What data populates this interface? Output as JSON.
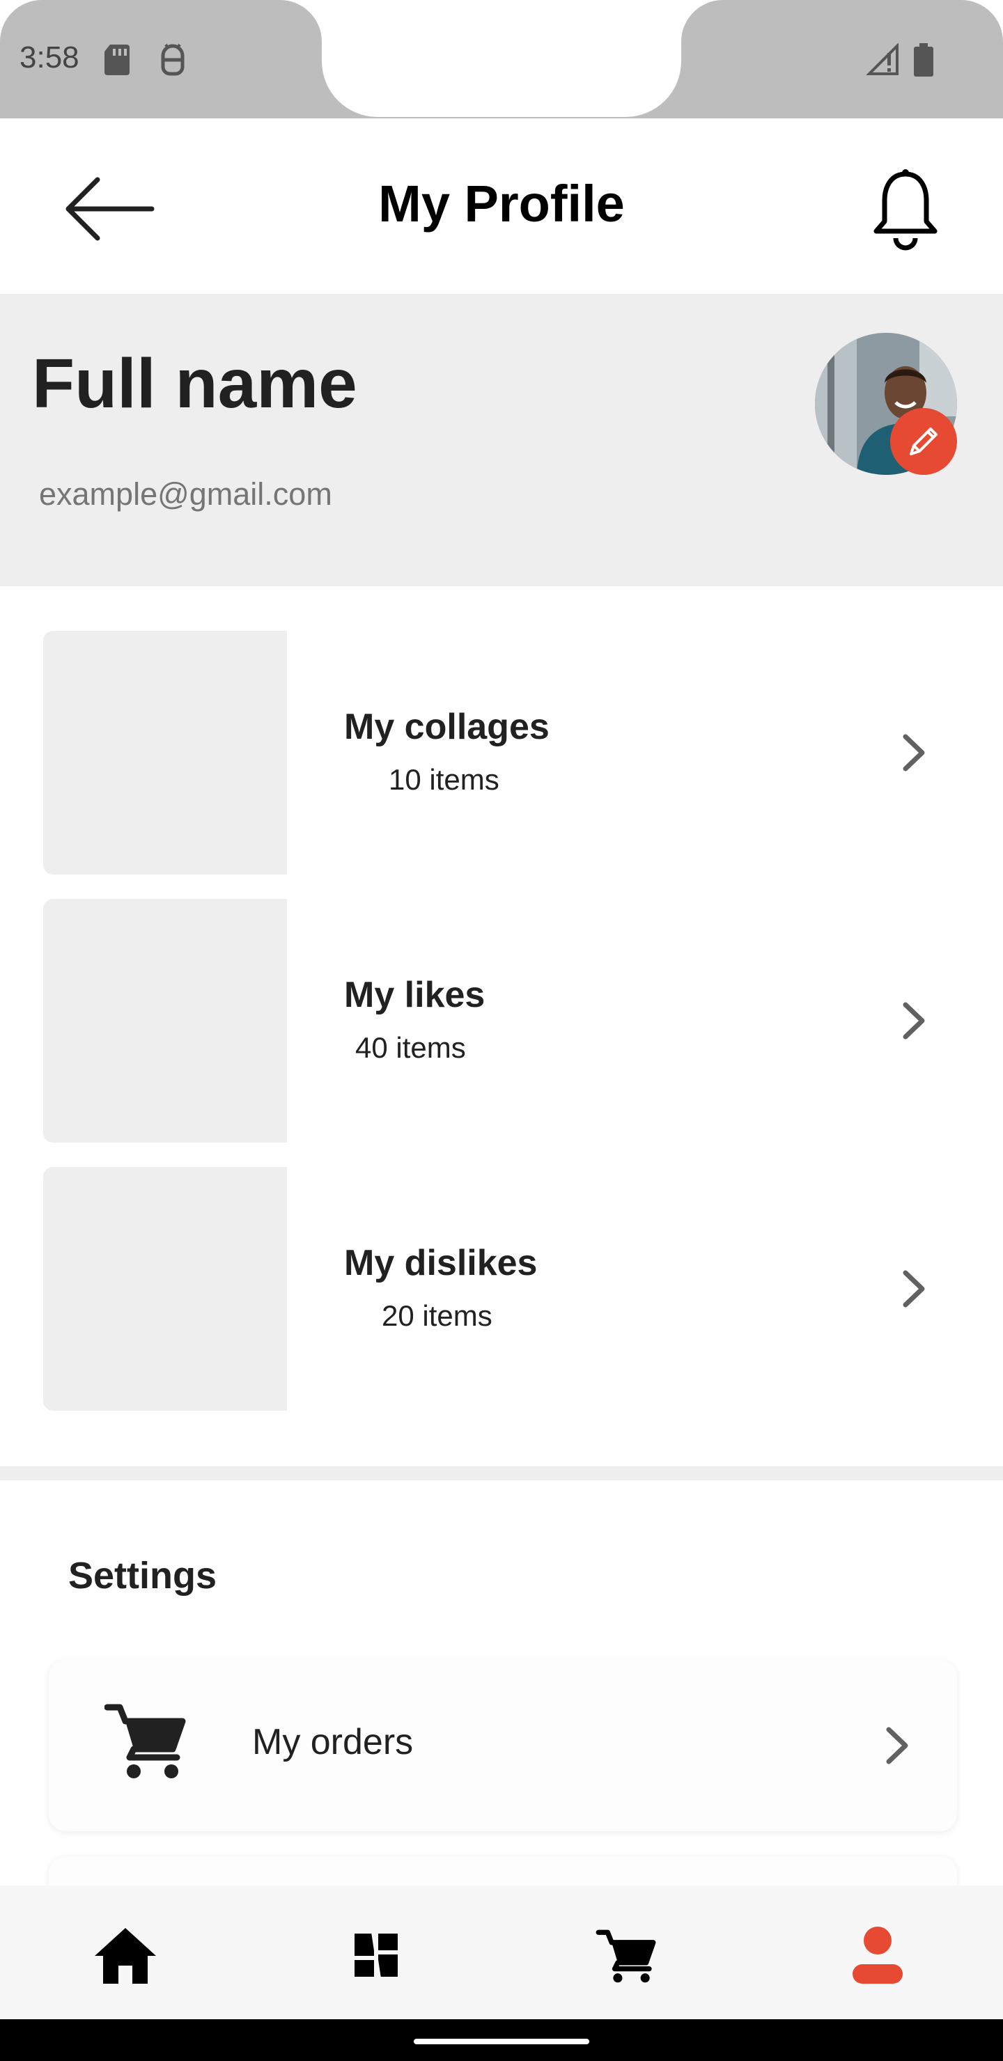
{
  "status_bar": {
    "time": "3:58",
    "icons": [
      "sd-card-icon",
      "android-debug-icon",
      "signal-icon",
      "battery-icon"
    ]
  },
  "header": {
    "title": "My Profile",
    "back_icon": "arrow-left-icon",
    "bell_icon": "bell-icon"
  },
  "profile": {
    "name": "Full name",
    "email": "example@gmail.com",
    "edit_icon": "pencil-icon"
  },
  "collections": [
    {
      "title": "My collages",
      "count": "10 items"
    },
    {
      "title": "My likes",
      "count": "40 items"
    },
    {
      "title": "My dislikes",
      "count": "20 items"
    }
  ],
  "settings": {
    "title": "Settings",
    "items": [
      {
        "label": "My orders",
        "icon": "cart-icon"
      }
    ]
  },
  "bottom_nav": {
    "items": [
      "home-icon",
      "collage-icon",
      "cart-icon",
      "person-icon"
    ],
    "active": "person-icon"
  },
  "colors": {
    "accent": "#e64a33",
    "section_bg": "#eeeeee",
    "status_bar": "#bdbdbd"
  }
}
